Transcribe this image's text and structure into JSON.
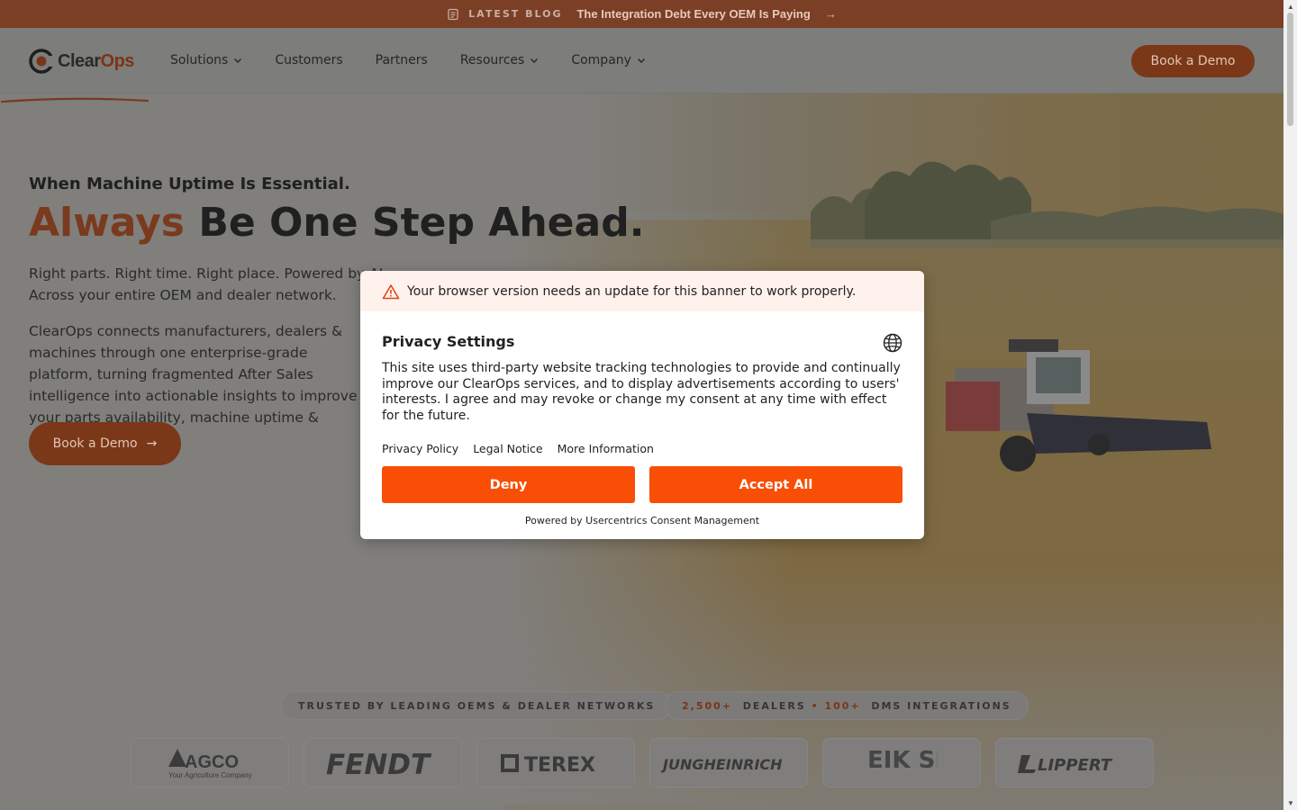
{
  "topbar": {
    "tag": "LATEST BLOG",
    "title": "The Integration Debt Every OEM Is Paying"
  },
  "nav": {
    "logo_part1": "Clear",
    "logo_part2": "Ops",
    "items": [
      {
        "label": "Solutions",
        "dropdown": true
      },
      {
        "label": "Customers",
        "dropdown": false
      },
      {
        "label": "Partners",
        "dropdown": false
      },
      {
        "label": "Resources",
        "dropdown": true
      },
      {
        "label": "Company",
        "dropdown": true
      }
    ],
    "cta": "Book a Demo"
  },
  "hero": {
    "eyebrow": "When Machine Uptime Is Essential.",
    "headline_accent": "Always",
    "headline_rest": " Be One Step Ahead.",
    "sub1": "Right parts. Right time. Right place. Powered by AI. Across your entire OEM and dealer network.",
    "sub2": "ClearOps connects manufacturers, dealers & machines through one enterprise-grade platform, turning fragmented After Sales intelligence into actionable insights to improve your parts availability, machine uptime & customer loyalty.",
    "cta": "Book a Demo"
  },
  "trusted": {
    "label": "TRUSTED BY LEADING OEMS & DEALER NETWORKS",
    "dealers_count": "2,500+",
    "dealers_label": "DEALERS",
    "dms_count": "100+",
    "dms_label": "DMS INTEGRATIONS",
    "logos": [
      "AGCO",
      "FENDT",
      "TEREX",
      "JUNGHEINRICH",
      "EIK SENTERET",
      "LIPPERT"
    ],
    "agco_tagline": "Your Agriculture Company"
  },
  "consent": {
    "warning": "Your browser version needs an update for this banner to work properly.",
    "title": "Privacy Settings",
    "body": "This site uses third-party website tracking technologies to provide and continually improve our ClearOps services, and to display advertisements according to users' interests. I agree and may revoke or change my consent at any time with effect for the future.",
    "links": [
      "Privacy Policy",
      "Legal Notice",
      "More Information"
    ],
    "deny": "Deny",
    "accept": "Accept All",
    "powered": "Powered by Usercentrics Consent Management"
  },
  "colors": {
    "accent": "#f94e05",
    "brand": "#c8561f"
  }
}
